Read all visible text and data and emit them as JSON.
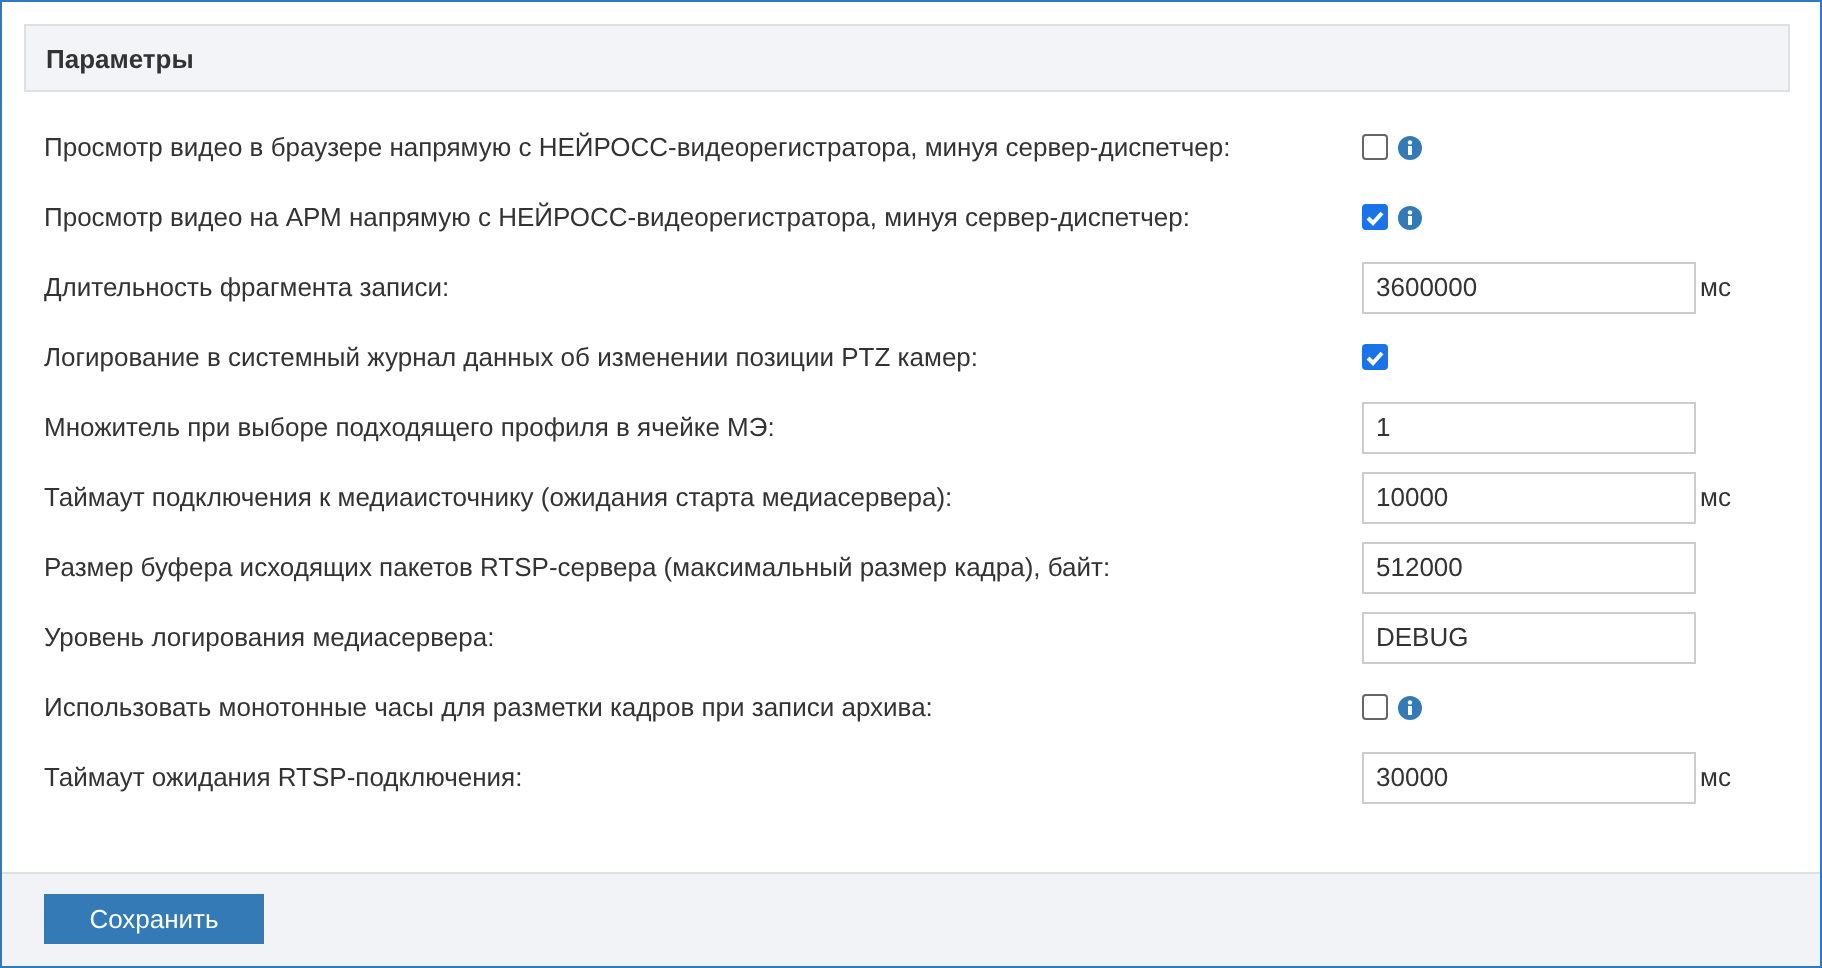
{
  "panel": {
    "title": "Параметры"
  },
  "settings": [
    {
      "kind": "checkbox",
      "label": "Просмотр видео в браузере напрямую с НЕЙРОСС-видеорегистратора, минуя сервер-диспетчер:",
      "checked": false,
      "info": true
    },
    {
      "kind": "checkbox",
      "label": "Просмотр видео на АРМ напрямую с НЕЙРОСС-видеорегистратора, минуя сервер-диспетчер:",
      "checked": true,
      "info": true
    },
    {
      "kind": "text",
      "label": "Длительность фрагмента записи:",
      "value": "3600000",
      "unit": "мс"
    },
    {
      "kind": "checkbox",
      "label": "Логирование в системный журнал данных об изменении позиции PTZ камер:",
      "checked": true,
      "info": false
    },
    {
      "kind": "text",
      "label": "Множитель при выборе подходящего профиля в ячейке МЭ:",
      "value": "1"
    },
    {
      "kind": "text",
      "label": "Таймаут подключения к медиаисточнику (ожидания старта медиасервера):",
      "value": "10000",
      "unit": "мс"
    },
    {
      "kind": "text",
      "label": "Размер буфера исходящих пакетов RTSP-сервера (максимальный размер кадра), байт:",
      "value": "512000"
    },
    {
      "kind": "text",
      "label": "Уровень логирования медиасервера:",
      "value": "DEBUG"
    },
    {
      "kind": "checkbox",
      "label": "Использовать монотонные часы для разметки кадров при записи архива:",
      "checked": false,
      "info": true
    },
    {
      "kind": "text",
      "label": "Таймаут ожидания RTSP-подключения:",
      "value": "30000",
      "unit": "мс"
    }
  ],
  "footer": {
    "save_button": "Сохранить"
  }
}
